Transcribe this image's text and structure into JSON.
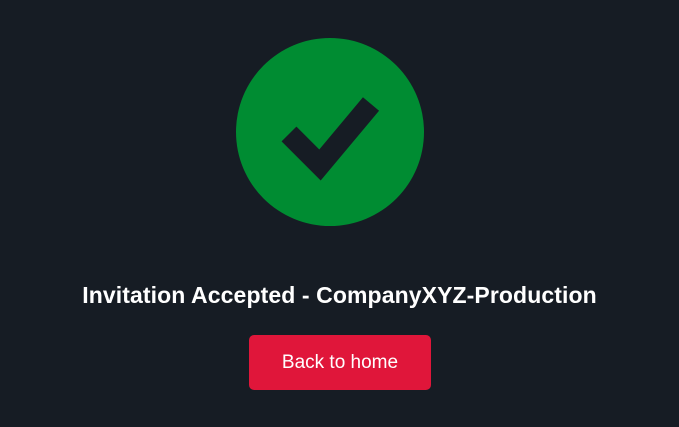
{
  "colors": {
    "background": "#161c24",
    "success": "#008c32",
    "accent": "#e0163a",
    "text": "#ffffff"
  },
  "status_icon": "check-circle-icon",
  "message": {
    "title": "Invitation Accepted - CompanyXYZ-Production"
  },
  "actions": {
    "back_label": "Back to home"
  }
}
